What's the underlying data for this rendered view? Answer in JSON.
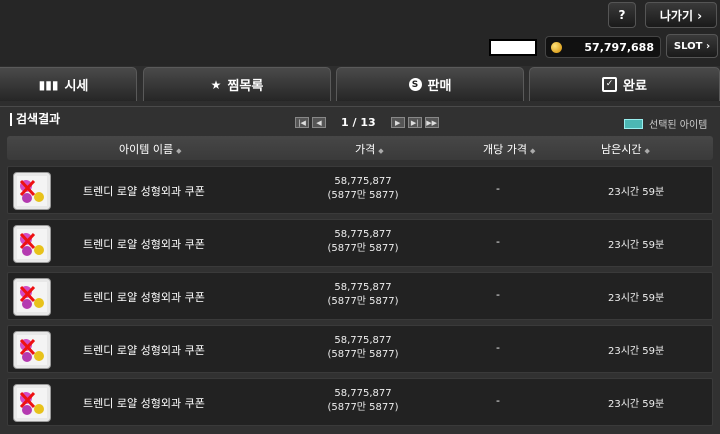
{
  "top": {
    "help_label": "?",
    "exit_label": "나가기 ›",
    "meso_amount": "57,797,688",
    "slot_label": "SLOT ›"
  },
  "tabs": [
    {
      "label": "시세",
      "icon": "bar-chart-icon"
    },
    {
      "label": "찜목록",
      "icon": "star-icon"
    },
    {
      "label": "판매",
      "icon": "s-coin-icon"
    },
    {
      "label": "완료",
      "icon": "checkbox-icon"
    }
  ],
  "results": {
    "title": "검색결과",
    "page_current": "1",
    "page_sep": "/",
    "page_total": "13",
    "selected_label": "선택된 아이템",
    "selected_color": "#4cb7b4"
  },
  "columns": {
    "item_name": "아이템 이름",
    "price": "가격",
    "unit_price": "개당 가격",
    "remaining": "남은시간"
  },
  "rows": [
    {
      "name": "트렌디 로얄 성형외과 쿠폰",
      "price": "58,775,877",
      "price_sub": "(5877만 5877)",
      "unit": "-",
      "time": "23시간 59분"
    },
    {
      "name": "트렌디 로얄 성형외과 쿠폰",
      "price": "58,775,877",
      "price_sub": "(5877만 5877)",
      "unit": "-",
      "time": "23시간 59분"
    },
    {
      "name": "트렌디 로얄 성형외과 쿠폰",
      "price": "58,775,877",
      "price_sub": "(5877만 5877)",
      "unit": "-",
      "time": "23시간 59분"
    },
    {
      "name": "트렌디 로얄 성형외과 쿠폰",
      "price": "58,775,877",
      "price_sub": "(5877만 5877)",
      "unit": "-",
      "time": "23시간 59분"
    },
    {
      "name": "트렌디 로얄 성형외과 쿠폰",
      "price": "58,775,877",
      "price_sub": "(5877만 5877)",
      "unit": "-",
      "time": "23시간 59분"
    }
  ]
}
